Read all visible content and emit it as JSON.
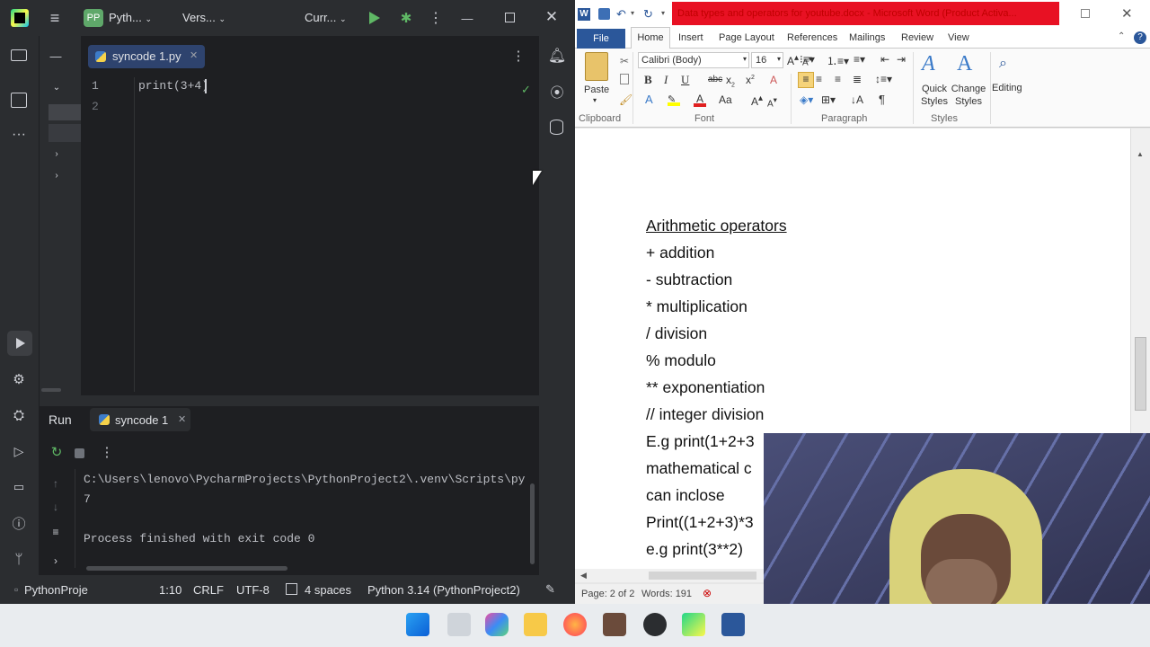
{
  "pycharm": {
    "project_badge": "PP",
    "project_name": "Pyth...",
    "vcs_label": "Vers...",
    "run_config": "Curr...",
    "editor_tab": "syncode 1.py",
    "code_line": "print(3+4)",
    "line_numbers": [
      "1",
      "2"
    ],
    "run_label": "Run",
    "run_tab": "syncode 1",
    "console_cmd": "C:\\Users\\lenovo\\PycharmProjects\\PythonProject2\\.venv\\Scripts\\py",
    "console_output": "7",
    "console_exit": "Process finished with exit code 0",
    "status": {
      "project": "PythonProje",
      "position": "1:10",
      "line_sep": "CRLF",
      "encoding": "UTF-8",
      "indent": "4 spaces",
      "interpreter": "Python 3.14 (PythonProject2)"
    }
  },
  "word": {
    "title": "Data types and operators for youtube.docx - Microsoft Word (Product Activa...",
    "tabs": [
      "File",
      "Home",
      "Insert",
      "Page Layout",
      "References",
      "Mailings",
      "Review",
      "View"
    ],
    "font_name": "Calibri (Body)",
    "font_size": "16",
    "groups": {
      "clipboard": "Clipboard",
      "font": "Font",
      "paragraph": "Paragraph",
      "styles": "Styles"
    },
    "paste": "Paste",
    "quick_styles": "Quick Styles",
    "change_styles": "Change Styles",
    "editing": "Editing",
    "doc_lines": [
      "Arithmetic operators",
      "+ addition",
      "-  subtraction",
      "*  multiplication",
      "/  division",
      "%  modulo",
      "** exponentiation",
      "//  integer division",
      "E.g print(1+2+3",
      "mathematical c",
      "can inclose",
      "Print((1+2+3)*3",
      "e.g print(3**2)"
    ],
    "status_page": "Page: 2 of 2",
    "status_words": "Words: 191"
  },
  "colors": {
    "pycharm_bg": "#1e1f22",
    "pycharm_panel": "#2b2d30",
    "word_title_red": "#e81123",
    "accent": "#3574f0"
  }
}
